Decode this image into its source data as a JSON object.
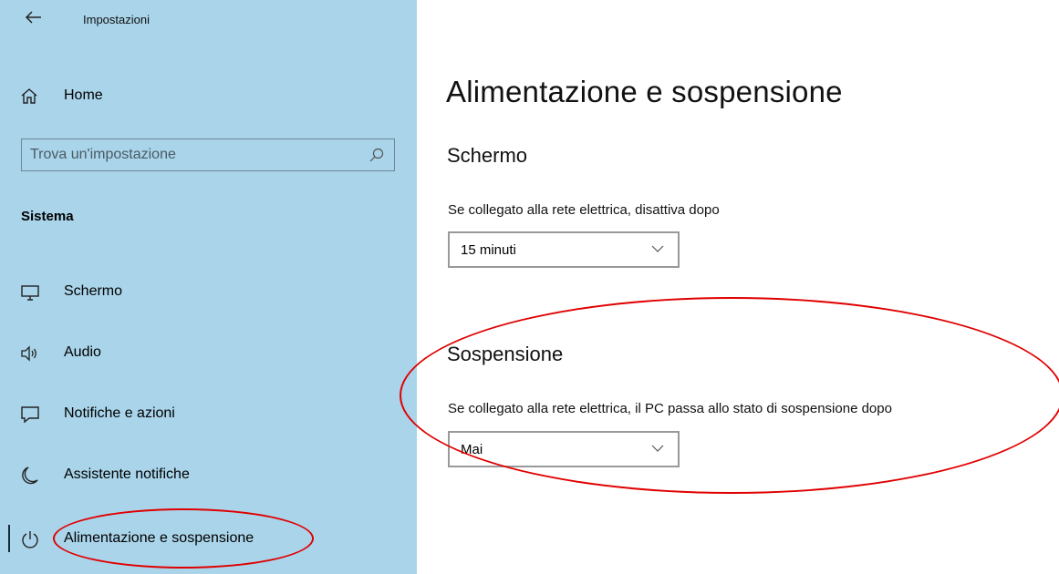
{
  "window": {
    "title": "Impostazioni"
  },
  "sidebar": {
    "home_label": "Home",
    "search_placeholder": "Trova un'impostazione",
    "section_label": "Sistema",
    "items": [
      {
        "label": "Schermo",
        "icon": "monitor-icon"
      },
      {
        "label": "Audio",
        "icon": "speaker-icon"
      },
      {
        "label": "Notifiche e azioni",
        "icon": "message-icon"
      },
      {
        "label": "Assistente notifiche",
        "icon": "moon-icon"
      },
      {
        "label": "Alimentazione e sospensione",
        "icon": "power-icon",
        "selected": true
      }
    ]
  },
  "main": {
    "title": "Alimentazione e sospensione",
    "screen": {
      "heading": "Schermo",
      "description": "Se collegato alla rete elettrica, disattiva dopo",
      "value": "15 minuti"
    },
    "sleep": {
      "heading": "Sospensione",
      "description": "Se collegato alla rete elettrica, il PC passa allo stato di sospensione dopo",
      "value": "Mai"
    }
  },
  "colors": {
    "sidebar_bg": "#a9d4ea",
    "annotation": "#e00000"
  }
}
